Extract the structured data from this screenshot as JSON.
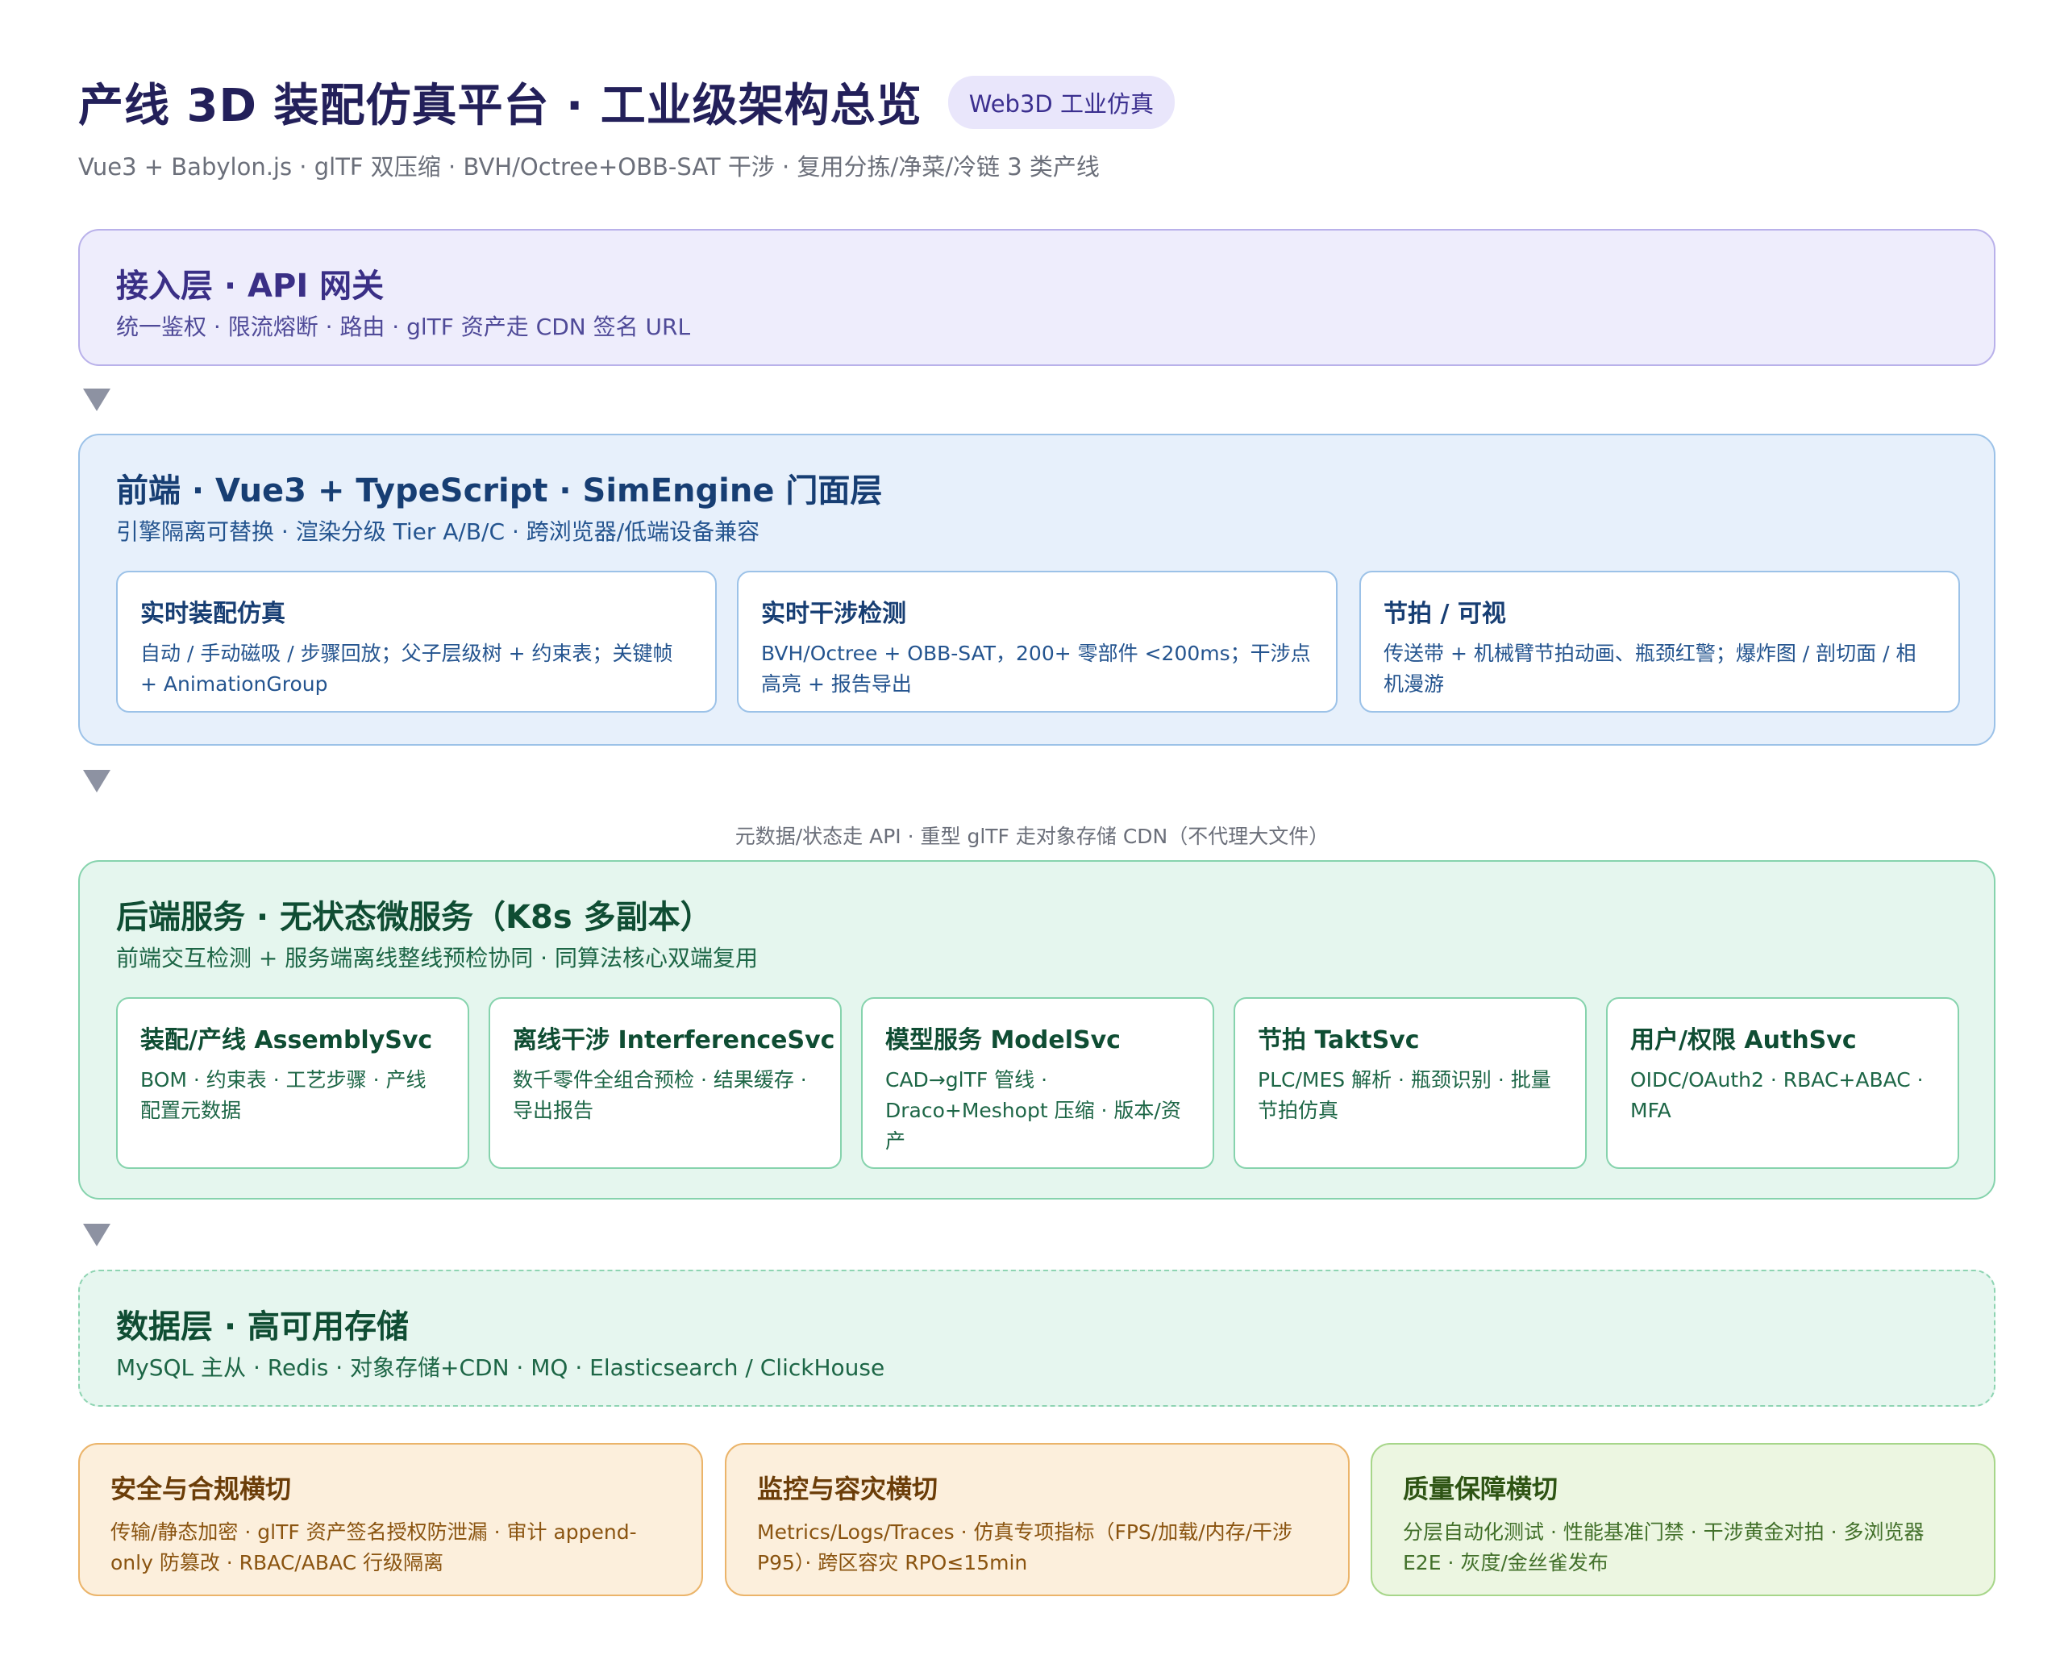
{
  "header": {
    "title": "产线 3D 装配仿真平台 · 工业级架构总览",
    "badge": "Web3D 工业仿真",
    "subtitle": "Vue3 + Babylon.js · glTF 双压缩 · BVH/Octree+OBB-SAT 干涉 · 复用分拣/净菜/冷链 3 类产线"
  },
  "access_layer": {
    "title": "接入层 · API 网关",
    "desc": "统一鉴权 · 限流熔断 · 路由 · glTF 资产走 CDN 签名 URL"
  },
  "frontend_layer": {
    "title": "前端 · Vue3 + TypeScript · SimEngine 门面层",
    "desc": "引擎隔离可替换 · 渲染分级 Tier A/B/C · 跨浏览器/低端设备兼容",
    "cards": [
      {
        "title": "实时装配仿真",
        "desc": "自动 / 手动磁吸 / 步骤回放；父子层级树 + 约束表；关键帧 + AnimationGroup"
      },
      {
        "title": "实时干涉检测",
        "desc": "BVH/Octree + OBB-SAT，200+ 零部件 <200ms；干涉点高亮 + 报告导出"
      },
      {
        "title": "节拍 / 可视",
        "desc": "传送带 + 机械臂节拍动画、瓶颈红警；爆炸图 / 剖切面 / 相机漫游"
      }
    ]
  },
  "flow_note": "元数据/状态走 API · 重型 glTF 走对象存储 CDN（不代理大文件）",
  "backend_layer": {
    "title": "后端服务 · 无状态微服务（K8s 多副本）",
    "desc": "前端交互检测 + 服务端离线整线预检协同 · 同算法核心双端复用",
    "cards": [
      {
        "title": "装配/产线 AssemblySvc",
        "desc": "BOM · 约束表 · 工艺步骤 · 产线配置元数据"
      },
      {
        "title": "离线干涉 InterferenceSvc",
        "desc": "数千零件全组合预检 · 结果缓存 · 导出报告"
      },
      {
        "title": "模型服务 ModelSvc",
        "desc": "CAD→glTF 管线 · Draco+Meshopt 压缩 · 版本/资产"
      },
      {
        "title": "节拍 TaktSvc",
        "desc": "PLC/MES 解析 · 瓶颈识别 · 批量节拍仿真"
      },
      {
        "title": "用户/权限 AuthSvc",
        "desc": "OIDC/OAuth2 · RBAC+ABAC · MFA"
      }
    ]
  },
  "data_layer": {
    "title": "数据层 · 高可用存储",
    "desc": "MySQL 主从 · Redis · 对象存储+CDN · MQ · Elasticsearch / ClickHouse"
  },
  "cross_cutting": [
    {
      "title": "安全与合规横切",
      "desc": "传输/静态加密 · glTF 资产签名授权防泄漏 · 审计 append-only 防篡改 · RBAC/ABAC 行级隔离"
    },
    {
      "title": "监控与容灾横切",
      "desc": "Metrics/Logs/Traces · 仿真专项指标（FPS/加载/内存/干涉 P95）· 跨区容灾 RPO≤15min"
    },
    {
      "title": "质量保障横切",
      "desc": "分层自动化测试 · 性能基准门禁 · 干涉黄金对拍 · 多浏览器 E2E · 灰度/金丝雀发布"
    }
  ]
}
